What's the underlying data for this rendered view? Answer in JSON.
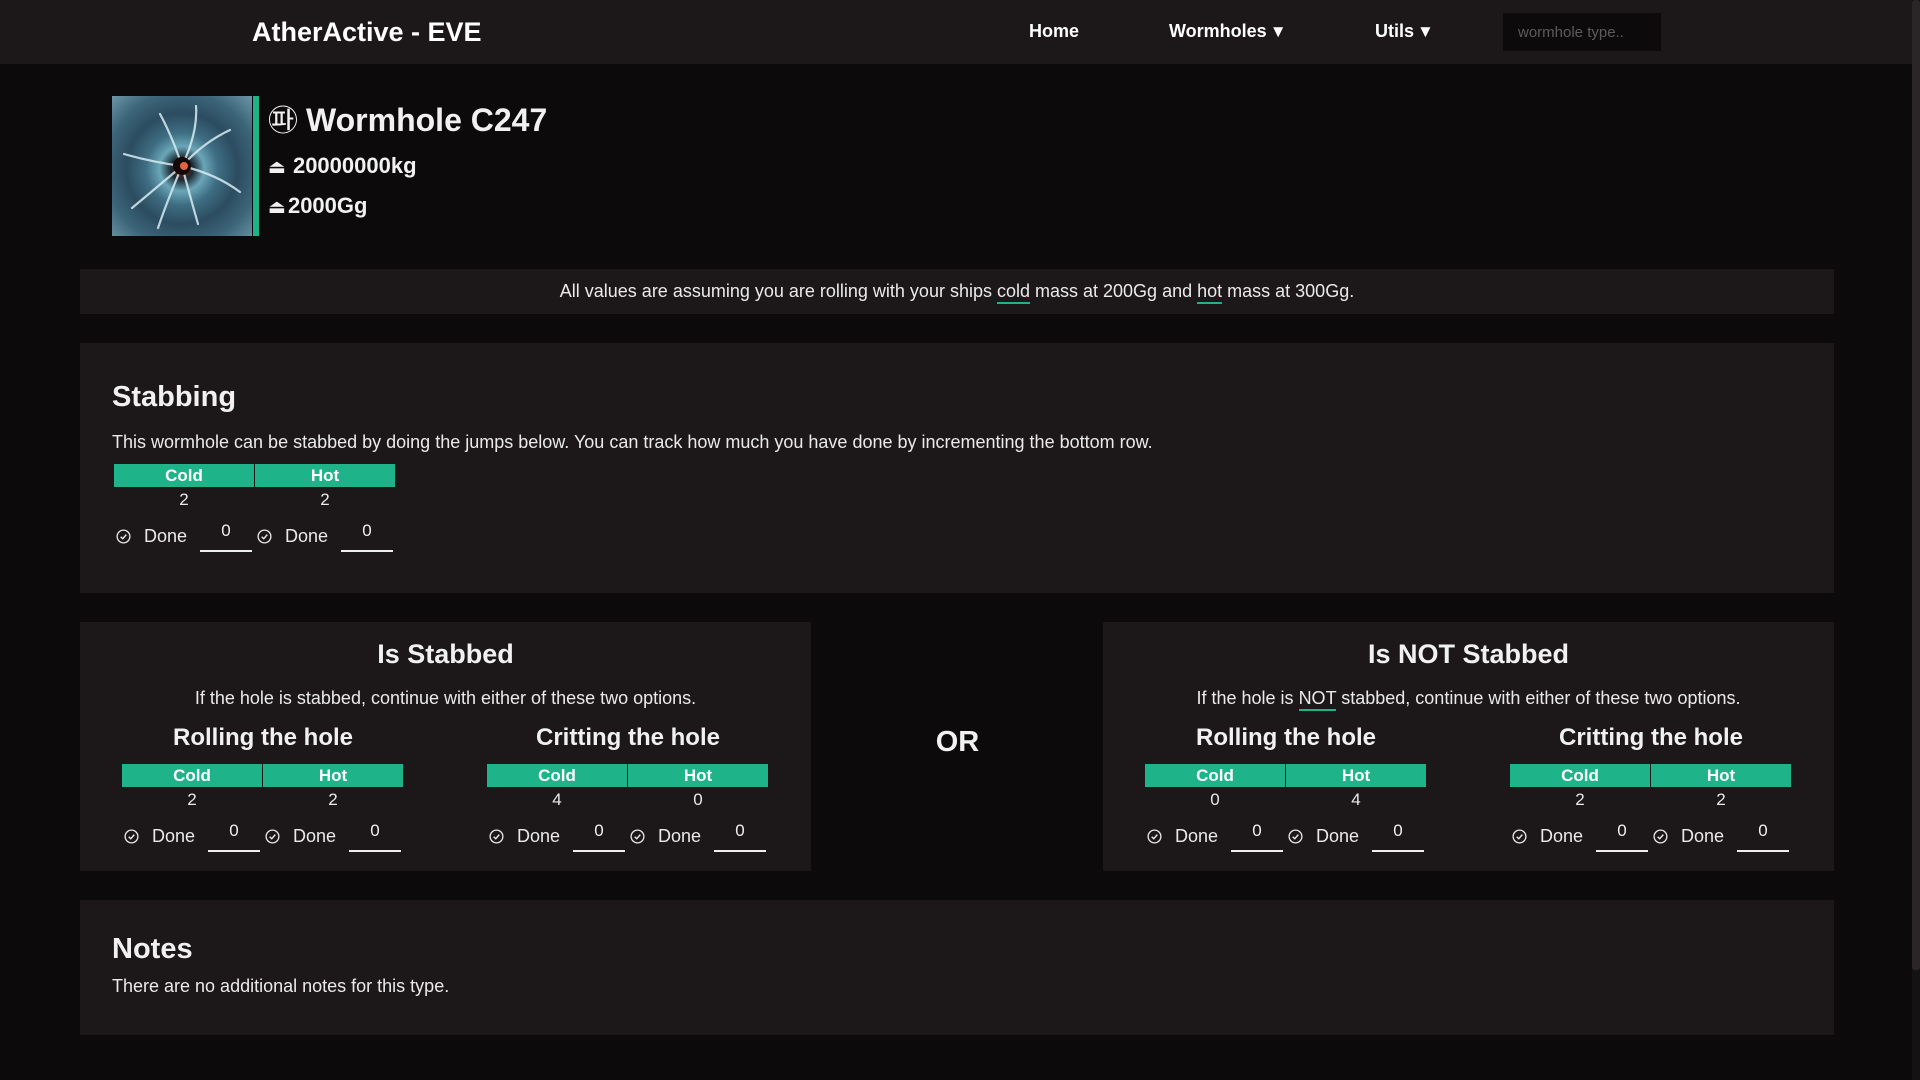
{
  "nav": {
    "brand": "AtherActive - EVE",
    "home": "Home",
    "wormholes": "Wormholes",
    "utils": "Utils",
    "caret": "▼",
    "search_placeholder": "wormhole type.."
  },
  "header": {
    "icon": "wormhole-icon",
    "icon_glyph": "㉺",
    "title": "Wormhole C247",
    "max_mass_icon": "mass-icon",
    "max_mass": "20000000kg",
    "jump_mass_icon": "jump-mass-icon",
    "jump_mass": "2000Gg"
  },
  "info": {
    "part1": "All values are assuming you are rolling with your ships ",
    "cold": "cold",
    "part2": " mass at 200Gg and ",
    "hot": "hot",
    "part3": " mass at 300Gg."
  },
  "stabbing": {
    "title": "Stabbing",
    "description": "This wormhole can be stabbed by doing the jumps below. You can track how much you have done by incrementing the bottom row.",
    "cold_label": "Cold",
    "hot_label": "Hot",
    "cold_count": "2",
    "hot_count": "2",
    "done_label": "Done",
    "cold_done": "0",
    "hot_done": "0"
  },
  "is_stabbed": {
    "title": "Is Stabbed",
    "description": "If the hole is stabbed, continue with either of these two options.",
    "rolling": {
      "title": "Rolling the hole",
      "cold_label": "Cold",
      "hot_label": "Hot",
      "cold_count": "2",
      "hot_count": "2",
      "done_label": "Done",
      "cold_done": "0",
      "hot_done": "0"
    },
    "critting": {
      "title": "Critting the hole",
      "cold_label": "Cold",
      "hot_label": "Hot",
      "cold_count": "4",
      "hot_count": "0",
      "done_label": "Done",
      "cold_done": "0",
      "hot_done": "0"
    }
  },
  "or_label": "OR",
  "not_stabbed": {
    "title": "Is NOT Stabbed",
    "desc_part1": "If the hole is ",
    "desc_not": "NOT",
    "desc_part2": " stabbed, continue with either of these two options.",
    "rolling": {
      "title": "Rolling the hole",
      "cold_label": "Cold",
      "hot_label": "Hot",
      "cold_count": "0",
      "hot_count": "4",
      "done_label": "Done",
      "cold_done": "0",
      "hot_done": "0"
    },
    "critting": {
      "title": "Critting the hole",
      "cold_label": "Cold",
      "hot_label": "Hot",
      "cold_count": "2",
      "hot_count": "2",
      "done_label": "Done",
      "cold_done": "0",
      "hot_done": "0"
    }
  },
  "notes": {
    "title": "Notes",
    "text": "There are no additional notes for this type."
  },
  "colors": {
    "accent": "#1fb389",
    "background": "#0c0a0b",
    "panel": "#1c1819"
  }
}
